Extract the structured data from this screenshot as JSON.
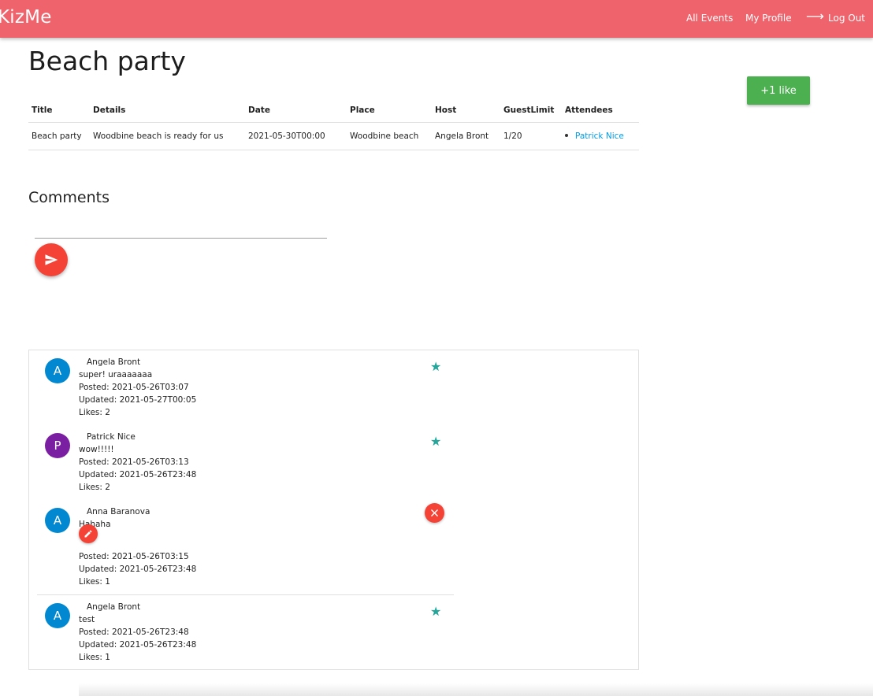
{
  "navbar": {
    "brand": "KizMe",
    "links": {
      "all_events": "All Events",
      "my_profile": "My Profile",
      "log_out": "Log Out"
    },
    "log_out_icon": "arrow-right-icon",
    "color": "#ef646c"
  },
  "event": {
    "title": "Beach party",
    "like_button_label": "+1 like",
    "table": {
      "headers": [
        "Title",
        "Details",
        "Date",
        "Place",
        "Host",
        "GuestLimit",
        "Attendees"
      ],
      "row": {
        "title": "Beach party",
        "details": "Woodbine beach is ready for us",
        "date": "2021-05-30T00:00",
        "place": "Woodbine beach",
        "host": "Angela Bront",
        "guest_limit": "1/20",
        "attendees": [
          "Patrick Nice"
        ]
      }
    }
  },
  "comments_section": {
    "heading": "Comments",
    "input_value": "",
    "send_icon": "send-icon",
    "items": [
      {
        "avatar": "A",
        "avatar_color": "#0288d1",
        "author": "Angela Bront",
        "text": "super! uraaaaaaa",
        "posted": "Posted: 2021-05-26T03:07",
        "updated": "Updated: 2021-05-27T00:05",
        "likes": "Likes: 2",
        "action": "star"
      },
      {
        "avatar": "P",
        "avatar_color": "#7b1fa2",
        "author": "Patrick Nice",
        "text": "wow!!!!!",
        "posted": "Posted: 2021-05-26T03:13",
        "updated": "Updated: 2021-05-26T23:48",
        "likes": "Likes: 2",
        "action": "star"
      },
      {
        "avatar": "A",
        "avatar_color": "#0288d1",
        "author": "Anna Baranova",
        "text": "Hahaha",
        "posted": "Posted: 2021-05-26T03:15",
        "updated": "Updated: 2021-05-26T23:48",
        "likes": "Likes: 1",
        "action": "delete"
      },
      {
        "avatar": "A",
        "avatar_color": "#0288d1",
        "author": "Angela Bront",
        "text": "test",
        "posted": "Posted: 2021-05-26T23:48",
        "updated": "Updated: 2021-05-26T23:48",
        "likes": "Likes: 1",
        "action": "star"
      }
    ]
  },
  "colors": {
    "like_button": "#4caf50",
    "action_red": "#f44336",
    "star_teal": "#26a69a",
    "link_blue": "#039be5"
  }
}
